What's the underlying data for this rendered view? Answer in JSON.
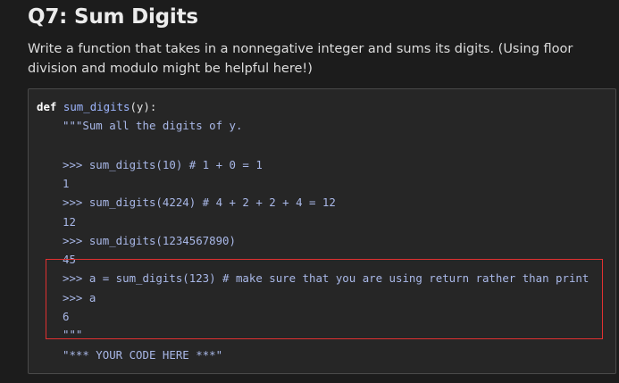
{
  "question": {
    "title": "Q7: Sum Digits",
    "description": "Write a function that takes in a nonnegative integer and sums its digits. (Using floor division and modulo might be helpful here!)"
  },
  "code": {
    "def_keyword": "def",
    "func_name": "sum_digits",
    "signature_rest": "(y):",
    "docstring_open": "\"\"\"Sum all the digits of y.",
    "lines": [
      ">>> sum_digits(10) # 1 + 0 = 1",
      "1",
      ">>> sum_digits(4224) # 4 + 2 + 2 + 4 = 12",
      "12",
      ">>> sum_digits(1234567890)",
      "45",
      ">>> a = sum_digits(123) # make sure that you are using return rather than print",
      ">>> a",
      "6",
      "\"\"\"",
      "\"*** YOUR CODE HERE ***\""
    ]
  },
  "colors": {
    "highlight_border": "#e03131",
    "background": "#1c1c1c",
    "code_background": "#262626"
  }
}
